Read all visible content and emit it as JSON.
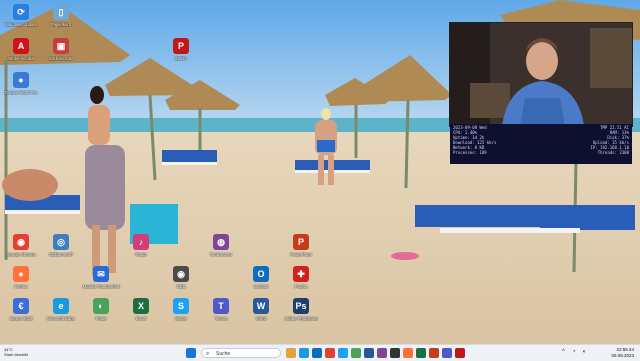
{
  "desktop_icons": [
    {
      "label": "Windows Update",
      "glyph": "⟳",
      "color": "#2a7de1",
      "icon": "update-icon"
    },
    {
      "label": "Papierkorb",
      "glyph": "▯",
      "color": "#6aa8d8",
      "icon": "recycle-bin-icon"
    },
    {
      "label": "Adobe Acrobat",
      "glyph": "A",
      "color": "#d0121b",
      "icon": "acrobat-icon"
    },
    {
      "label": "Stick-Einsatz",
      "glyph": "▣",
      "color": "#c83c3c",
      "icon": "stick-icon"
    },
    {
      "label": "Google Earth Pro",
      "glyph": "●",
      "color": "#3a7bd5",
      "icon": "earth-icon"
    },
    {
      "label": "Google Chrome",
      "glyph": "◉",
      "color": "#e34133",
      "icon": "chrome-icon"
    },
    {
      "label": "CDBurnerXP",
      "glyph": "◎",
      "color": "#3b7fbf",
      "icon": "disc-icon"
    },
    {
      "label": "Firefox",
      "glyph": "●",
      "color": "#ff7139",
      "icon": "firefox-icon"
    },
    {
      "label": "Steuer 2023",
      "glyph": "€",
      "color": "#3a6fd8",
      "icon": "tax-icon"
    },
    {
      "label": "Microsoft Edge",
      "glyph": "e",
      "color": "#1a9be0",
      "icon": "edge-icon"
    },
    {
      "label": "Fotos",
      "glyph": "◐",
      "color": "#4aa35a",
      "icon": "photos-icon"
    },
    {
      "label": "22534",
      "glyph": "P",
      "color": "#c01818",
      "icon": "pdf-icon"
    },
    {
      "label": "Mozilla Thunderbird",
      "glyph": "✉",
      "color": "#2a6ad8",
      "icon": "thunderbird-icon"
    },
    {
      "label": "Skype",
      "glyph": "S",
      "color": "#1da1f2",
      "icon": "skype-icon"
    },
    {
      "label": "Tor Browser",
      "glyph": "◍",
      "color": "#7d4698",
      "icon": "tor-icon"
    },
    {
      "label": "Outlook",
      "glyph": "O",
      "color": "#0f6cbd",
      "icon": "outlook-icon"
    },
    {
      "label": "Word",
      "glyph": "W",
      "color": "#2b579a",
      "icon": "word-icon"
    },
    {
      "label": "Excel",
      "glyph": "X",
      "color": "#1d6f42",
      "icon": "excel-icon"
    },
    {
      "label": "PowerPoint",
      "glyph": "P",
      "color": "#c43e1c",
      "icon": "powerpoint-icon"
    },
    {
      "label": "Adobe Photoshop",
      "glyph": "Ps",
      "color": "#1c3f6e",
      "icon": "photoshop-icon"
    },
    {
      "label": "Radio",
      "glyph": "♪",
      "color": "#d23c7a",
      "icon": "radio-icon"
    },
    {
      "label": "OBS",
      "glyph": "◉",
      "color": "#4a4a4a",
      "icon": "obs-icon"
    },
    {
      "label": "Puzzle",
      "glyph": "✚",
      "color": "#d02020",
      "icon": "puzzle-icon"
    },
    {
      "label": "Teams",
      "glyph": "T",
      "color": "#5059c9",
      "icon": "teams-icon"
    }
  ],
  "sysinfo": [
    [
      "2023-09-09 Wed",
      "TMP 22.51 AC"
    ],
    [
      "CPU: 2.40%",
      "RAM: 13%"
    ],
    [
      "Uptime: 1d 2h",
      "Disk: 37%"
    ],
    [
      "Download: 125 kb/s",
      "Upload: 15 kb/s"
    ],
    [
      "Network: 0 KB",
      "IP: 192.168.1.10"
    ],
    [
      "Processes: 189",
      "Threads: 2300"
    ]
  ],
  "taskbar": {
    "weather_temp": "34°C",
    "weather_desc": "Stark bewölkt",
    "search_placeholder": "Suche",
    "time": "22:55:44",
    "date": "09.08.2023"
  },
  "taskbar_apps": [
    {
      "color": "#e2a23b",
      "icon": "file-explorer-icon"
    },
    {
      "color": "#1a9be0",
      "icon": "edge-icon"
    },
    {
      "color": "#0f6cbd",
      "icon": "mail-icon"
    },
    {
      "color": "#e34133",
      "icon": "chrome-icon"
    },
    {
      "color": "#1da1f2",
      "icon": "skype-icon"
    },
    {
      "color": "#4aa35a",
      "icon": "photos-icon"
    },
    {
      "color": "#2b579a",
      "icon": "word-icon"
    },
    {
      "color": "#7d4698",
      "icon": "tor-icon"
    },
    {
      "color": "#333",
      "icon": "terminal-icon"
    },
    {
      "color": "#ff7139",
      "icon": "firefox-icon"
    },
    {
      "color": "#1d6f42",
      "icon": "excel-icon"
    },
    {
      "color": "#c43e1c",
      "icon": "powerpoint-icon"
    },
    {
      "color": "#5059c9",
      "icon": "teams-icon"
    },
    {
      "color": "#c01818",
      "icon": "acrobat-icon"
    }
  ]
}
